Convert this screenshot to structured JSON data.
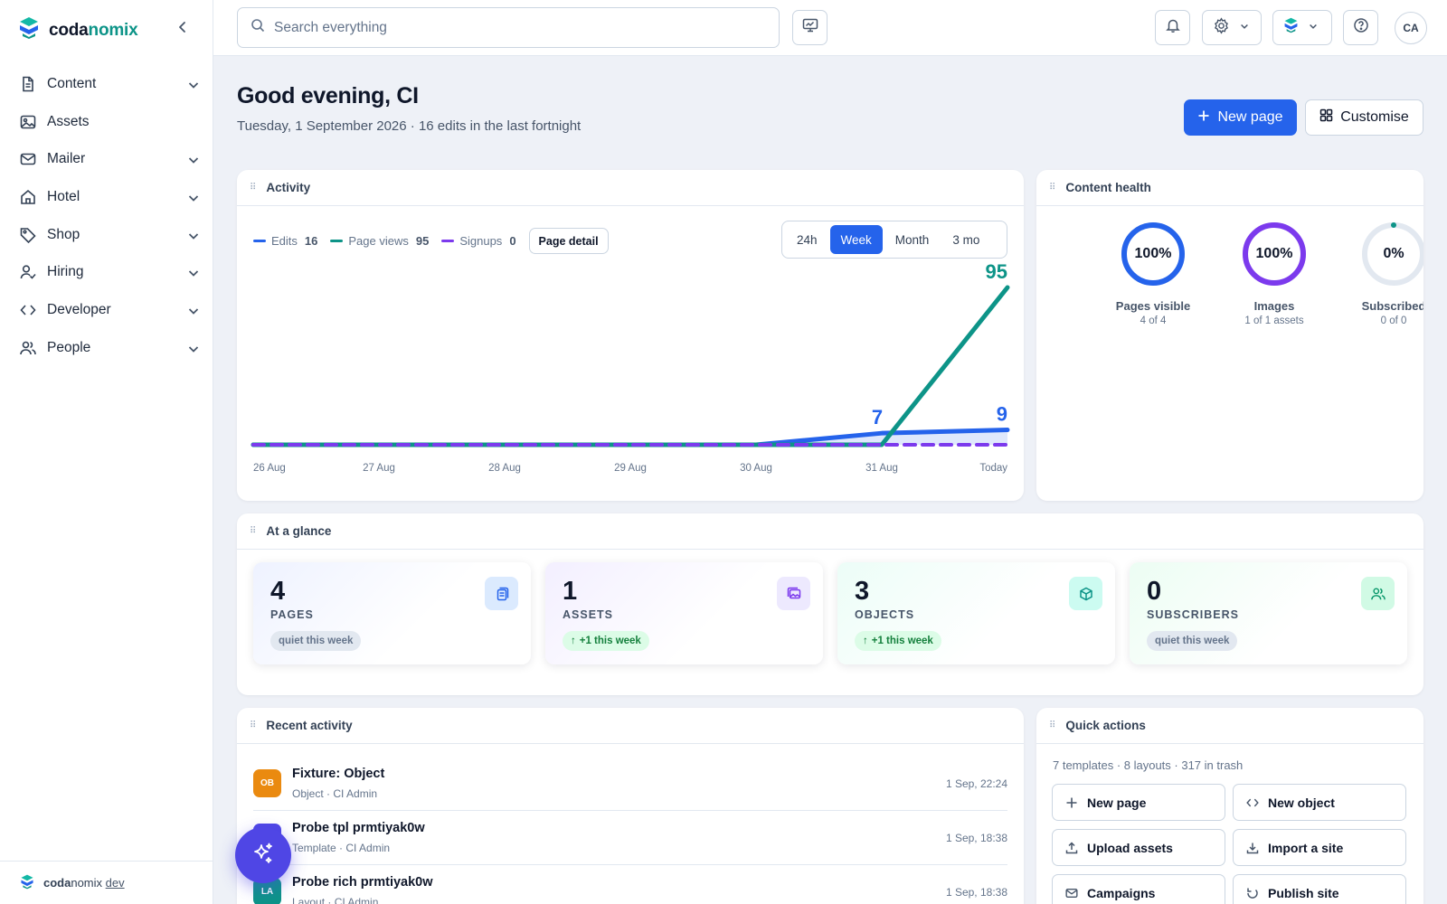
{
  "app": {
    "brand_a": "coda",
    "brand_b": "nomix",
    "footer_brand_a": "coda",
    "footer_brand_b": "nomix",
    "footer_env": "dev"
  },
  "sidebar": {
    "items": [
      {
        "label": "Content",
        "icon": "document-icon",
        "expandable": true
      },
      {
        "label": "Assets",
        "icon": "image-icon",
        "expandable": false
      },
      {
        "label": "Mailer",
        "icon": "mail-icon",
        "expandable": true
      },
      {
        "label": "Hotel",
        "icon": "home-icon",
        "expandable": true
      },
      {
        "label": "Shop",
        "icon": "tag-icon",
        "expandable": true
      },
      {
        "label": "Hiring",
        "icon": "user-check-icon",
        "expandable": true
      },
      {
        "label": "Developer",
        "icon": "code-icon",
        "expandable": true
      },
      {
        "label": "People",
        "icon": "users-icon",
        "expandable": true
      }
    ]
  },
  "topbar": {
    "search_placeholder": "Search everything",
    "avatar_initials": "CA"
  },
  "header": {
    "greeting": "Good evening, CI",
    "subtitle": "Tuesday, 1 September 2026 · 16 edits in the last fortnight",
    "new_page_label": "New page",
    "customise_label": "Customise"
  },
  "activity": {
    "title": "Activity",
    "legend": [
      {
        "name": "Edits",
        "value": "16",
        "color": "#2563eb"
      },
      {
        "name": "Page views",
        "value": "95",
        "color": "#0d9488"
      },
      {
        "name": "Signups",
        "value": "0",
        "color": "#7c3aed"
      }
    ],
    "detail_label": "Page detail",
    "ranges": [
      "24h",
      "Week",
      "Month",
      "3 mo"
    ],
    "active_range": "Week"
  },
  "chart_data": {
    "type": "line",
    "categories": [
      "26 Aug",
      "27 Aug",
      "28 Aug",
      "29 Aug",
      "30 Aug",
      "31 Aug",
      "Today"
    ],
    "series": [
      {
        "name": "Edits",
        "values": [
          0,
          0,
          0,
          0,
          0,
          7,
          9
        ],
        "color": "#2563eb"
      },
      {
        "name": "Page views",
        "values": [
          0,
          0,
          0,
          0,
          0,
          0,
          95
        ],
        "color": "#0d9488"
      },
      {
        "name": "Signups",
        "values": [
          0,
          0,
          0,
          0,
          0,
          0,
          0
        ],
        "color": "#7c3aed"
      }
    ],
    "data_labels": [
      {
        "series": "Edits",
        "category": "31 Aug",
        "value": "7"
      },
      {
        "series": "Edits",
        "category": "Today",
        "value": "9"
      },
      {
        "series": "Page views",
        "category": "Today",
        "value": "95"
      }
    ],
    "ylim": [
      0,
      95
    ]
  },
  "health": {
    "title": "Content health",
    "rings": [
      {
        "pct": "100%",
        "fraction": 1.0,
        "label": "Pages visible",
        "sub": "4 of 4",
        "color": "#2563eb"
      },
      {
        "pct": "100%",
        "fraction": 1.0,
        "label": "Images",
        "sub": "1 of 1 assets",
        "color": "#7c3aed"
      },
      {
        "pct": "0%",
        "fraction": 0.0,
        "label": "Subscribed",
        "sub": "0 of 0",
        "color": "#0d9488"
      }
    ]
  },
  "glance": {
    "title": "At a glance",
    "stats": [
      {
        "value": "4",
        "label": "PAGES",
        "chip": "quiet this week",
        "trend": "quiet",
        "icon": "pages-icon"
      },
      {
        "value": "1",
        "label": "ASSETS",
        "chip": "+1 this week",
        "trend": "up",
        "icon": "images-icon"
      },
      {
        "value": "3",
        "label": "OBJECTS",
        "chip": "+1 this week",
        "trend": "up",
        "icon": "cube-icon"
      },
      {
        "value": "0",
        "label": "SUBSCRIBERS",
        "chip": "quiet this week",
        "trend": "quiet",
        "icon": "users-icon"
      }
    ]
  },
  "recent": {
    "title": "Recent activity",
    "rows": [
      {
        "badge": "OB",
        "color": "#ea8a10",
        "title": "Fixture: Object",
        "meta": "Object · CI Admin",
        "date": "1 Sep, 22:24"
      },
      {
        "badge": "TP",
        "color": "#4f46e5",
        "title": "Probe tpl prmtiyak0w",
        "meta": "Template · CI Admin",
        "date": "1 Sep, 18:38"
      },
      {
        "badge": "LA",
        "color": "#0d9488",
        "title": "Probe rich prmtiyak0w",
        "meta": "Layout · CI Admin",
        "date": "1 Sep, 18:38"
      }
    ]
  },
  "quick": {
    "title": "Quick actions",
    "meta": "7 templates · 8 layouts · 317 in trash",
    "actions": [
      {
        "label": "New page",
        "icon": "plus-icon"
      },
      {
        "label": "New object",
        "icon": "code-icon"
      },
      {
        "label": "Upload assets",
        "icon": "upload-icon"
      },
      {
        "label": "Import a site",
        "icon": "download-icon"
      },
      {
        "label": "Campaigns",
        "icon": "mail-icon"
      },
      {
        "label": "Publish site",
        "icon": "refresh-icon"
      }
    ]
  }
}
